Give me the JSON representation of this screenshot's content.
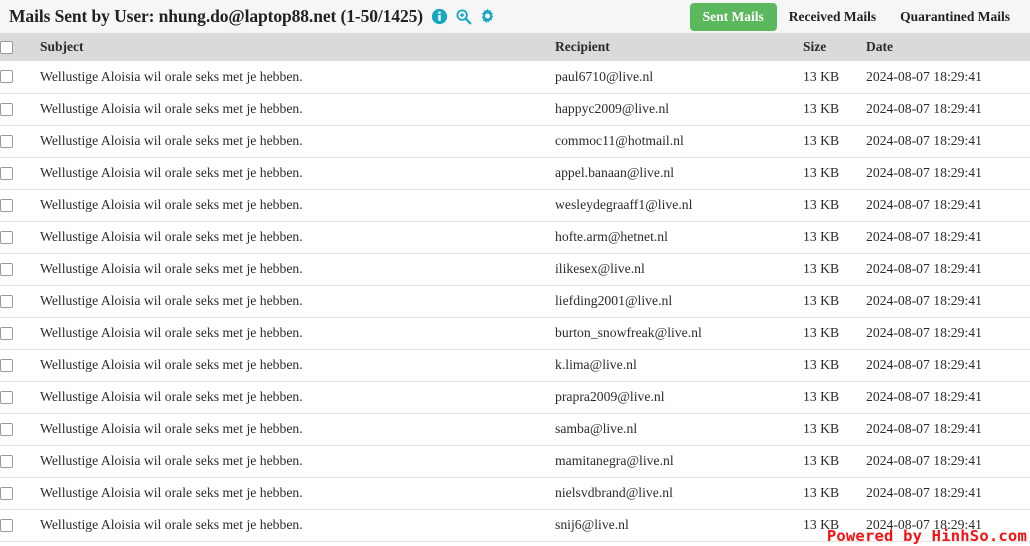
{
  "header": {
    "title": "Mails Sent by User: nhung.do@laptop88.net (1-50/1425)",
    "icons": [
      {
        "name": "info-icon",
        "label": "info"
      },
      {
        "name": "zoom-in-icon",
        "label": "zoom-in"
      },
      {
        "name": "gear-icon",
        "label": "settings"
      }
    ],
    "icon_color": "#17a8c0",
    "background": "#f6f6f6"
  },
  "tabs": [
    {
      "label": "Sent Mails",
      "active": true
    },
    {
      "label": "Received Mails",
      "active": false
    },
    {
      "label": "Quarantined Mails",
      "active": false
    }
  ],
  "tab_active_color": "#5cb85c",
  "table": {
    "header_background": "#dadada",
    "columns": [
      "",
      "Subject",
      "Recipient",
      "Size",
      "Date"
    ],
    "rows": [
      {
        "subject": "Wellustige Aloisia wil orale seks met je hebben.",
        "recipient": "paul6710@live.nl",
        "size": "13 KB",
        "date": "2024-08-07 18:29:41"
      },
      {
        "subject": "Wellustige Aloisia wil orale seks met je hebben.",
        "recipient": "happyc2009@live.nl",
        "size": "13 KB",
        "date": "2024-08-07 18:29:41"
      },
      {
        "subject": "Wellustige Aloisia wil orale seks met je hebben.",
        "recipient": "commoc11@hotmail.nl",
        "size": "13 KB",
        "date": "2024-08-07 18:29:41"
      },
      {
        "subject": "Wellustige Aloisia wil orale seks met je hebben.",
        "recipient": "appel.banaan@live.nl",
        "size": "13 KB",
        "date": "2024-08-07 18:29:41"
      },
      {
        "subject": "Wellustige Aloisia wil orale seks met je hebben.",
        "recipient": "wesleydegraaff1@live.nl",
        "size": "13 KB",
        "date": "2024-08-07 18:29:41"
      },
      {
        "subject": "Wellustige Aloisia wil orale seks met je hebben.",
        "recipient": "hofte.arm@hetnet.nl",
        "size": "13 KB",
        "date": "2024-08-07 18:29:41"
      },
      {
        "subject": "Wellustige Aloisia wil orale seks met je hebben.",
        "recipient": "ilikesex@live.nl",
        "size": "13 KB",
        "date": "2024-08-07 18:29:41"
      },
      {
        "subject": "Wellustige Aloisia wil orale seks met je hebben.",
        "recipient": "liefding2001@live.nl",
        "size": "13 KB",
        "date": "2024-08-07 18:29:41"
      },
      {
        "subject": "Wellustige Aloisia wil orale seks met je hebben.",
        "recipient": "burton_snowfreak@live.nl",
        "size": "13 KB",
        "date": "2024-08-07 18:29:41"
      },
      {
        "subject": "Wellustige Aloisia wil orale seks met je hebben.",
        "recipient": "k.lima@live.nl",
        "size": "13 KB",
        "date": "2024-08-07 18:29:41"
      },
      {
        "subject": "Wellustige Aloisia wil orale seks met je hebben.",
        "recipient": "prapra2009@live.nl",
        "size": "13 KB",
        "date": "2024-08-07 18:29:41"
      },
      {
        "subject": "Wellustige Aloisia wil orale seks met je hebben.",
        "recipient": "samba@live.nl",
        "size": "13 KB",
        "date": "2024-08-07 18:29:41"
      },
      {
        "subject": "Wellustige Aloisia wil orale seks met je hebben.",
        "recipient": "mamitanegra@live.nl",
        "size": "13 KB",
        "date": "2024-08-07 18:29:41"
      },
      {
        "subject": "Wellustige Aloisia wil orale seks met je hebben.",
        "recipient": "nielsvdbrand@live.nl",
        "size": "13 KB",
        "date": "2024-08-07 18:29:41"
      },
      {
        "subject": "Wellustige Aloisia wil orale seks met je hebben.",
        "recipient": "snij6@live.nl",
        "size": "13 KB",
        "date": "2024-08-07 18:29:41"
      }
    ]
  },
  "watermark": {
    "text": "Powered by HinhSo.com",
    "color": "#f81010"
  }
}
